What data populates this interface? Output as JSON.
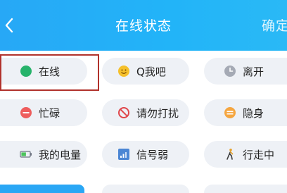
{
  "header": {
    "title": "在线状态",
    "confirm_label": "确定"
  },
  "statuses": [
    {
      "label": "在线",
      "icon": "green-dot-icon",
      "color": "#27b36b"
    },
    {
      "label": "Q我吧",
      "icon": "smiley-icon",
      "color": "#f5c02b"
    },
    {
      "label": "离开",
      "icon": "clock-icon",
      "color": "#a5aab5"
    },
    {
      "label": "忙碌",
      "icon": "busy-minus-icon",
      "color": "#ee5d5d"
    },
    {
      "label": "请勿打扰",
      "icon": "do-not-disturb-icon",
      "color": "#e0464a"
    },
    {
      "label": "隐身",
      "icon": "invisible-icon",
      "color": "#f5a640"
    },
    {
      "label": "我的电量",
      "icon": "battery-icon",
      "color": "#4cc35c"
    },
    {
      "label": "信号弱",
      "icon": "signal-icon",
      "color": "#4b86d4"
    },
    {
      "label": "行走中",
      "icon": "walking-icon",
      "color": "#e6a12c"
    }
  ],
  "colors": {
    "header_bg": "#22b4f8",
    "selected_outline": "#b1322c",
    "pill_bg": "#eef1f6"
  }
}
